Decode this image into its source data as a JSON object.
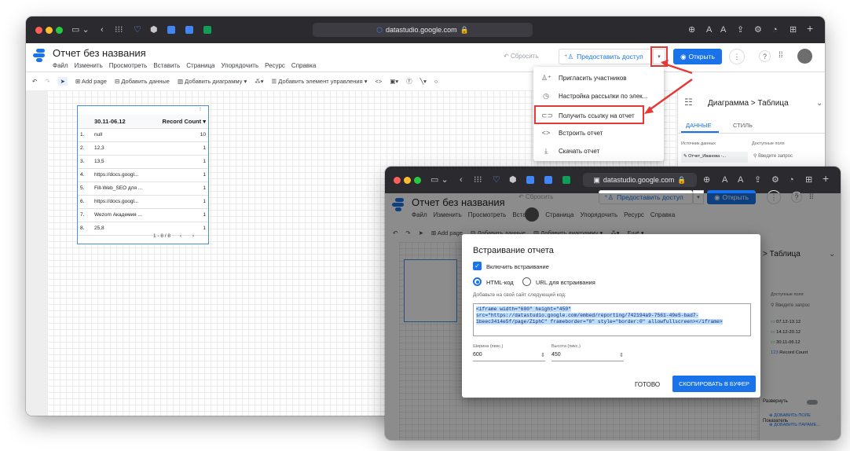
{
  "browser": {
    "url": "datastudio.google.com",
    "url2": "datastudio.google.com"
  },
  "app": {
    "title": "Отчет без названия",
    "menu": [
      "Файл",
      "Изменить",
      "Просмотреть",
      "Вставить",
      "Страница",
      "Упорядочить",
      "Ресурс",
      "Справка"
    ],
    "reset_label": "Сбросить",
    "share_label": "Предоставить доступ",
    "open_label": "Открыть"
  },
  "toolbar": {
    "add_page": "Add page",
    "add_data": "Добавить данные",
    "add_chart": "Добавить диаграмму",
    "add_control": "Добавить элемент управления",
    "more": "Ещё"
  },
  "table": {
    "headers": [
      "30.11-06.12",
      "Record Count"
    ],
    "rows": [
      {
        "n": "1.",
        "name": "null",
        "count": "10"
      },
      {
        "n": "2.",
        "name": "12,3",
        "count": "1"
      },
      {
        "n": "3.",
        "name": "13,5",
        "count": "1"
      },
      {
        "n": "4.",
        "name": "https://docs.googl...",
        "count": "1"
      },
      {
        "n": "5.",
        "name": "Fill-Web_SEO для ...",
        "count": "1"
      },
      {
        "n": "6.",
        "name": "https://docs.googl...",
        "count": "1"
      },
      {
        "n": "7.",
        "name": "Wezom Академия ...",
        "count": "1"
      },
      {
        "n": "8.",
        "name": "25,8",
        "count": "1"
      }
    ],
    "pagination": "1 - 8 / 8"
  },
  "dropdown": {
    "items": [
      {
        "icon": "add-person-icon",
        "label": "Пригласить участников"
      },
      {
        "icon": "clock-icon",
        "label": "Настройка рассылки по элек..."
      },
      {
        "icon": "link-icon",
        "label": "Получить ссылку на отчет"
      },
      {
        "icon": "code-icon",
        "label": "Встроить отчет"
      },
      {
        "icon": "download-icon",
        "label": "Скачать отчет"
      }
    ]
  },
  "panel": {
    "breadcrumb_a": "Диаграмма",
    "breadcrumb_b": "Таблица",
    "tab_data": "ДАННЫЕ",
    "tab_style": "СТИЛЬ",
    "source_label": "Источник данных",
    "source_value": "Отчет_Иванова -...",
    "fields_label": "Доступные поля",
    "search_placeholder": "Введите запрос"
  },
  "panel2": {
    "breadcrumb_b": "Таблица",
    "fields_label": "Доступные поля",
    "search_placeholder": "Введите запрос",
    "fields": [
      "07.12-13.12",
      "14.12-20.12",
      "30.11-06.12",
      "Record Count"
    ],
    "expand": "Развернуть",
    "metric": "Показатель",
    "add_field": "ДОБАВИТЬ ПОЛЕ",
    "add_param": "ДОБАВИТЬ ПАРАМЕ..."
  },
  "dialog": {
    "title": "Встраивание отчета",
    "enable_label": "Включить встраивание",
    "radio_html": "HTML-код",
    "radio_url": "URL для встраивания",
    "instruction": "Добавьте на свой сайт следующий код:",
    "code": "<iframe width=\"600\" height=\"450\" src=\"https://datastudio.google.com/embed/reporting/742194a9-7561-49e5-bad7-1beec3414e5f/page/Z1phC\" frameborder=\"0\" style=\"border:0\" allowfullscreen></iframe>",
    "width_label": "Ширина (пикс.)",
    "width_value": "600",
    "height_label": "Высота (пикс.)",
    "height_value": "450",
    "done_label": "ГОТОВО",
    "copy_label": "СКОПИРОВАТЬ В БУФЕР"
  },
  "colors": {
    "accent": "#1a73e8",
    "annotation": "#e53935",
    "titlebar": "#2b2a2f"
  }
}
